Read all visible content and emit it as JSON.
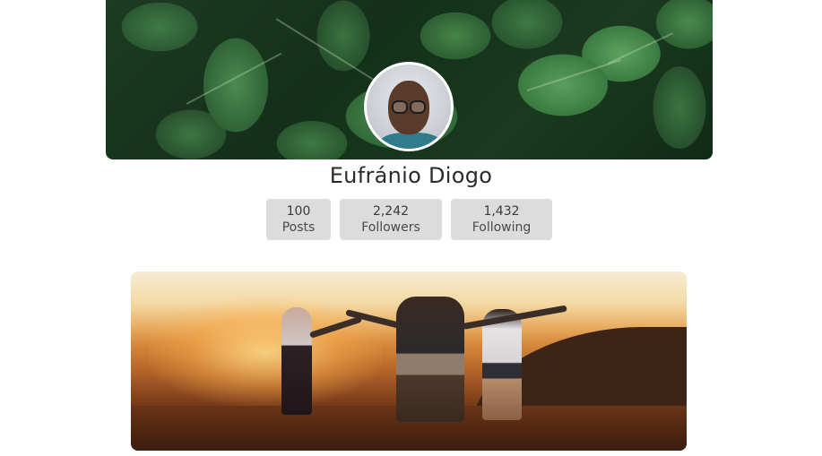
{
  "profile": {
    "name": "Eufránio Diogo",
    "avatar_alt": "profile photo"
  },
  "stats": {
    "posts": {
      "value": "100",
      "label": "Posts"
    },
    "followers": {
      "value": "2,242",
      "label": "Followers"
    },
    "following": {
      "value": "1,432",
      "label": "Following"
    }
  },
  "colors": {
    "stat_bg": "#dcdcdc",
    "name_text": "#2b2b2b"
  }
}
